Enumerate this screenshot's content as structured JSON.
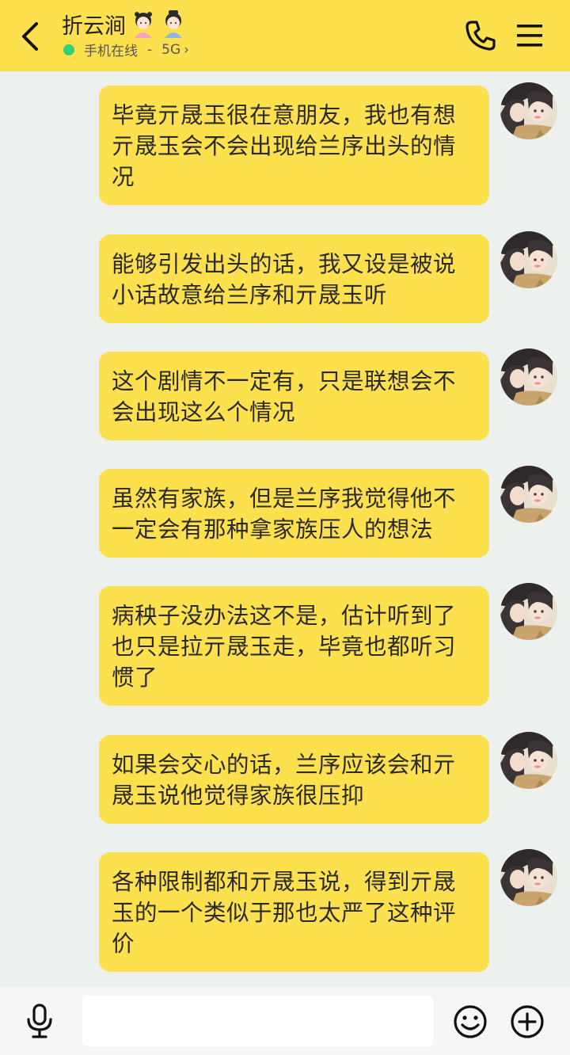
{
  "header": {
    "contact_name": "折云涧",
    "status": "手机在线",
    "separator": "-",
    "network": "5G",
    "chevron": "›"
  },
  "messages": [
    {
      "text": "毕竟亓晟玉很在意朋友，我也有想亓晟玉会不会出现给兰序出头的情况"
    },
    {
      "text": "能够引发出头的话，我又设是被说小话故意给兰序和亓晟玉听"
    },
    {
      "text": "这个剧情不一定有，只是联想会不会出现这么个情况"
    },
    {
      "text": "虽然有家族，但是兰序我觉得他不一定会有那种拿家族压人的想法"
    },
    {
      "text": "病秧子没办法这不是，估计听到了也只是拉亓晟玉走，毕竟也都听习惯了"
    },
    {
      "text": "如果会交心的话，兰序应该会和亓晟玉说他觉得家族很压抑"
    },
    {
      "text": "各种限制都和亓晟玉说，得到亓晟玉的一个类似于那也太严了这种评价"
    }
  ],
  "colors": {
    "accent": "#FDE04E",
    "background": "#EDF1EE",
    "online": "#33D17A"
  },
  "icons": [
    "back-arrow-icon",
    "phone-icon",
    "menu-icon",
    "microphone-icon",
    "emoji-icon",
    "plus-icon"
  ]
}
